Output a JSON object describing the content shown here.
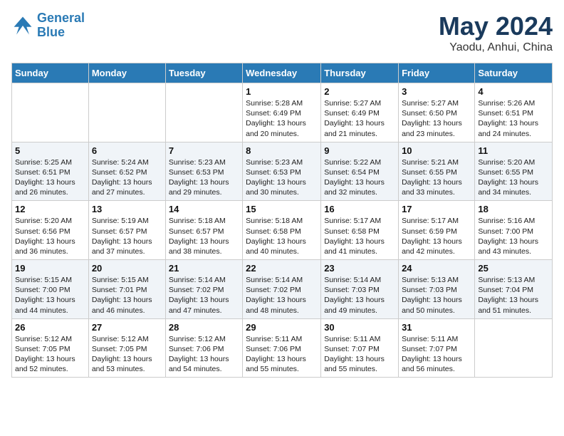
{
  "header": {
    "logo_line1": "General",
    "logo_line2": "Blue",
    "month": "May 2024",
    "location": "Yaodu, Anhui, China"
  },
  "weekdays": [
    "Sunday",
    "Monday",
    "Tuesday",
    "Wednesday",
    "Thursday",
    "Friday",
    "Saturday"
  ],
  "weeks": [
    [
      {
        "day": "",
        "info": ""
      },
      {
        "day": "",
        "info": ""
      },
      {
        "day": "",
        "info": ""
      },
      {
        "day": "1",
        "info": "Sunrise: 5:28 AM\nSunset: 6:49 PM\nDaylight: 13 hours\nand 20 minutes."
      },
      {
        "day": "2",
        "info": "Sunrise: 5:27 AM\nSunset: 6:49 PM\nDaylight: 13 hours\nand 21 minutes."
      },
      {
        "day": "3",
        "info": "Sunrise: 5:27 AM\nSunset: 6:50 PM\nDaylight: 13 hours\nand 23 minutes."
      },
      {
        "day": "4",
        "info": "Sunrise: 5:26 AM\nSunset: 6:51 PM\nDaylight: 13 hours\nand 24 minutes."
      }
    ],
    [
      {
        "day": "5",
        "info": "Sunrise: 5:25 AM\nSunset: 6:51 PM\nDaylight: 13 hours\nand 26 minutes."
      },
      {
        "day": "6",
        "info": "Sunrise: 5:24 AM\nSunset: 6:52 PM\nDaylight: 13 hours\nand 27 minutes."
      },
      {
        "day": "7",
        "info": "Sunrise: 5:23 AM\nSunset: 6:53 PM\nDaylight: 13 hours\nand 29 minutes."
      },
      {
        "day": "8",
        "info": "Sunrise: 5:23 AM\nSunset: 6:53 PM\nDaylight: 13 hours\nand 30 minutes."
      },
      {
        "day": "9",
        "info": "Sunrise: 5:22 AM\nSunset: 6:54 PM\nDaylight: 13 hours\nand 32 minutes."
      },
      {
        "day": "10",
        "info": "Sunrise: 5:21 AM\nSunset: 6:55 PM\nDaylight: 13 hours\nand 33 minutes."
      },
      {
        "day": "11",
        "info": "Sunrise: 5:20 AM\nSunset: 6:55 PM\nDaylight: 13 hours\nand 34 minutes."
      }
    ],
    [
      {
        "day": "12",
        "info": "Sunrise: 5:20 AM\nSunset: 6:56 PM\nDaylight: 13 hours\nand 36 minutes."
      },
      {
        "day": "13",
        "info": "Sunrise: 5:19 AM\nSunset: 6:57 PM\nDaylight: 13 hours\nand 37 minutes."
      },
      {
        "day": "14",
        "info": "Sunrise: 5:18 AM\nSunset: 6:57 PM\nDaylight: 13 hours\nand 38 minutes."
      },
      {
        "day": "15",
        "info": "Sunrise: 5:18 AM\nSunset: 6:58 PM\nDaylight: 13 hours\nand 40 minutes."
      },
      {
        "day": "16",
        "info": "Sunrise: 5:17 AM\nSunset: 6:58 PM\nDaylight: 13 hours\nand 41 minutes."
      },
      {
        "day": "17",
        "info": "Sunrise: 5:17 AM\nSunset: 6:59 PM\nDaylight: 13 hours\nand 42 minutes."
      },
      {
        "day": "18",
        "info": "Sunrise: 5:16 AM\nSunset: 7:00 PM\nDaylight: 13 hours\nand 43 minutes."
      }
    ],
    [
      {
        "day": "19",
        "info": "Sunrise: 5:15 AM\nSunset: 7:00 PM\nDaylight: 13 hours\nand 44 minutes."
      },
      {
        "day": "20",
        "info": "Sunrise: 5:15 AM\nSunset: 7:01 PM\nDaylight: 13 hours\nand 46 minutes."
      },
      {
        "day": "21",
        "info": "Sunrise: 5:14 AM\nSunset: 7:02 PM\nDaylight: 13 hours\nand 47 minutes."
      },
      {
        "day": "22",
        "info": "Sunrise: 5:14 AM\nSunset: 7:02 PM\nDaylight: 13 hours\nand 48 minutes."
      },
      {
        "day": "23",
        "info": "Sunrise: 5:14 AM\nSunset: 7:03 PM\nDaylight: 13 hours\nand 49 minutes."
      },
      {
        "day": "24",
        "info": "Sunrise: 5:13 AM\nSunset: 7:03 PM\nDaylight: 13 hours\nand 50 minutes."
      },
      {
        "day": "25",
        "info": "Sunrise: 5:13 AM\nSunset: 7:04 PM\nDaylight: 13 hours\nand 51 minutes."
      }
    ],
    [
      {
        "day": "26",
        "info": "Sunrise: 5:12 AM\nSunset: 7:05 PM\nDaylight: 13 hours\nand 52 minutes."
      },
      {
        "day": "27",
        "info": "Sunrise: 5:12 AM\nSunset: 7:05 PM\nDaylight: 13 hours\nand 53 minutes."
      },
      {
        "day": "28",
        "info": "Sunrise: 5:12 AM\nSunset: 7:06 PM\nDaylight: 13 hours\nand 54 minutes."
      },
      {
        "day": "29",
        "info": "Sunrise: 5:11 AM\nSunset: 7:06 PM\nDaylight: 13 hours\nand 55 minutes."
      },
      {
        "day": "30",
        "info": "Sunrise: 5:11 AM\nSunset: 7:07 PM\nDaylight: 13 hours\nand 55 minutes."
      },
      {
        "day": "31",
        "info": "Sunrise: 5:11 AM\nSunset: 7:07 PM\nDaylight: 13 hours\nand 56 minutes."
      },
      {
        "day": "",
        "info": ""
      }
    ]
  ]
}
